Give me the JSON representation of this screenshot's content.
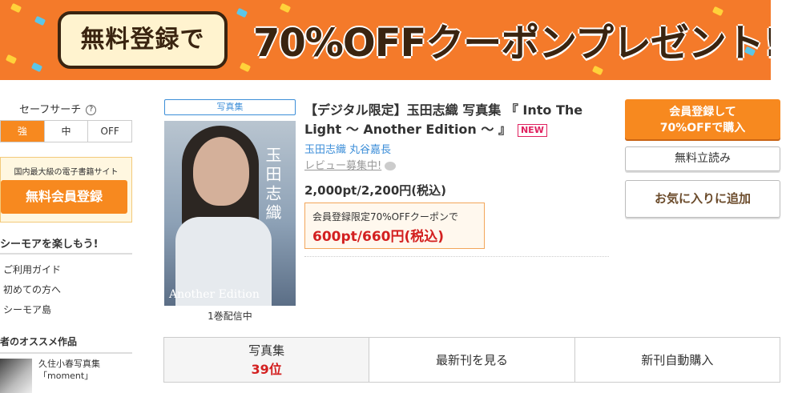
{
  "banner": {
    "pill_text": "無料登録で",
    "main_text": "70%OFFクーポンプレゼント!"
  },
  "sidebar": {
    "safe_search_label": "セーフサーチ",
    "help_icon": "?",
    "safe_options": [
      "強",
      "中",
      "OFF"
    ],
    "signup_caption": "国内最大級の電子書籍サイト",
    "signup_button": "無料会員登録",
    "enjoy_heading": "シーモアを楽しもう!",
    "guide_links": [
      "ご利用ガイド",
      "初めての方へ",
      "シーモア島"
    ],
    "recommend_heading": "者のオススメ作品",
    "recommend_item_line1": "久住小春写真集",
    "recommend_item_line2": "「moment」"
  },
  "product": {
    "category_tag": "写真集",
    "cover_vertical_title": "玉田志織",
    "cover_subtitle": "Another Edition",
    "volumes": "1巻配信中",
    "title": "【デジタル限定】玉田志織 写真集 『 Into The Light 〜 Another Edition 〜 』",
    "new_badge": "NEW",
    "authors": [
      "玉田志織",
      "丸谷嘉長"
    ],
    "review_text": "レビュー募集中!",
    "price": "2,000pt/2,200円(税込)",
    "coupon_label": "会員登録限定70%OFFクーポンで",
    "coupon_price": "600pt/660円(税込)"
  },
  "actions": {
    "buy_line1": "会員登録して",
    "buy_line2": "70%OFFで購入",
    "trial_read": "無料立読み",
    "favorite": "お気に入りに追加"
  },
  "bottom_bar": {
    "rank_category": "写真集",
    "rank_value": "39位",
    "latest": "最新刊を見る",
    "auto_buy": "新刊自動購入"
  },
  "colors": {
    "accent_orange": "#f7891f",
    "link_blue": "#3c8ed8",
    "price_red": "#d32020"
  }
}
